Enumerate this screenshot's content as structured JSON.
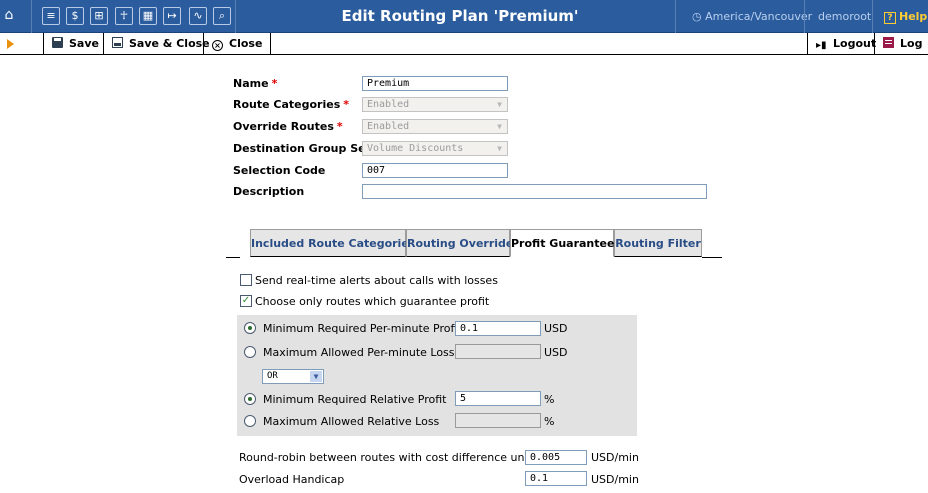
{
  "header": {
    "title": "Edit Routing Plan 'Premium'",
    "timezone": "America/Vancouver",
    "user": "demoroot",
    "help": "Help"
  },
  "toolbar": {
    "save": "Save",
    "save_close": "Save & Close",
    "close": "Close",
    "logout": "Logout",
    "log": "Log"
  },
  "form": {
    "name_label": "Name",
    "name_value": "Premium",
    "route_categories_label": "Route Categories",
    "route_categories_value": "Enabled",
    "override_routes_label": "Override Routes",
    "override_routes_value": "Enabled",
    "destination_group_set_label": "Destination Group Set",
    "destination_group_set_value": "Volume Discounts",
    "selection_code_label": "Selection Code",
    "selection_code_value": "007",
    "description_label": "Description",
    "description_value": "",
    "required_mark": "*"
  },
  "tabs": [
    {
      "label": "Included Route Categories"
    },
    {
      "label": "Routing Override"
    },
    {
      "label": "Profit Guarantee"
    },
    {
      "label": "Routing Filter"
    }
  ],
  "profit": {
    "send_alerts_label": "Send real-time alerts about calls with losses",
    "send_alerts_checked": false,
    "choose_routes_label": "Choose only routes which guarantee profit",
    "choose_routes_checked": true,
    "min_per_minute_label": "Minimum Required Per-minute Profit",
    "min_per_minute_value": "0.1",
    "min_per_minute_unit": "USD",
    "max_per_minute_label": "Maximum Allowed Per-minute Loss",
    "max_per_minute_value": "",
    "max_per_minute_unit": "USD",
    "operator_value": "OR",
    "min_relative_label": "Minimum Required Relative Profit",
    "min_relative_value": "5",
    "min_relative_unit": "%",
    "max_relative_label": "Maximum Allowed Relative Loss",
    "max_relative_value": "",
    "max_relative_unit": "%",
    "round_robin_label": "Round-robin between routes with cost difference under",
    "round_robin_value": "0.005",
    "round_robin_unit": "USD/min",
    "overload_label": "Overload Handicap",
    "overload_value": "0.1",
    "overload_unit": "USD/min"
  },
  "colors": {
    "topbar": "#2b5d9e",
    "tab_link": "#2a4d86",
    "help": "#ffcc33"
  },
  "icons": [
    "home-icon",
    "list-icon",
    "dollar-icon",
    "grid-icon",
    "person-icon",
    "dashboard-icon",
    "exit-icon",
    "chart-icon",
    "search-icon"
  ]
}
